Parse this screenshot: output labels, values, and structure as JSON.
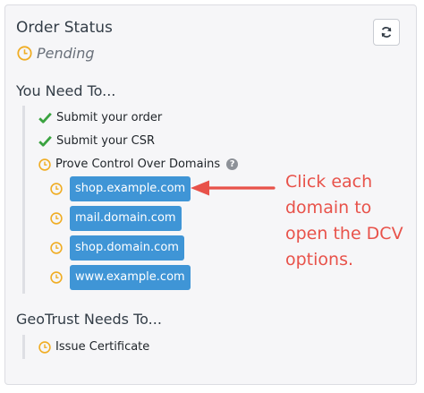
{
  "header": {
    "title": "Order Status",
    "status": "Pending"
  },
  "you_need_to": {
    "heading": "You Need To...",
    "tasks": [
      {
        "label": "Submit your order",
        "state": "done",
        "icon": "check-icon"
      },
      {
        "label": "Submit your CSR",
        "state": "done",
        "icon": "check-icon"
      },
      {
        "label": "Prove Control Over Domains",
        "state": "pending",
        "icon": "clock-icon",
        "help_icon": "question-circle-icon"
      }
    ],
    "domains": [
      "shop.example.com",
      "mail.domain.com",
      "shop.domain.com",
      "www.example.com"
    ]
  },
  "geotrust_needs_to": {
    "heading": "GeoTrust Needs To...",
    "tasks": [
      {
        "label": "Issue Certificate",
        "state": "pending",
        "icon": "clock-icon"
      }
    ]
  },
  "annotation": {
    "text": "Click each domain to open the DCV options.",
    "icon": "arrow-left-icon"
  },
  "colors": {
    "accent_blue": "#3f95d6",
    "check_green": "#3aa340",
    "clock_orange": "#f0ad24",
    "annotation_red": "#e8524a"
  },
  "icons": {
    "refresh": "refresh-icon",
    "pending": "clock-icon",
    "done": "check-icon"
  }
}
